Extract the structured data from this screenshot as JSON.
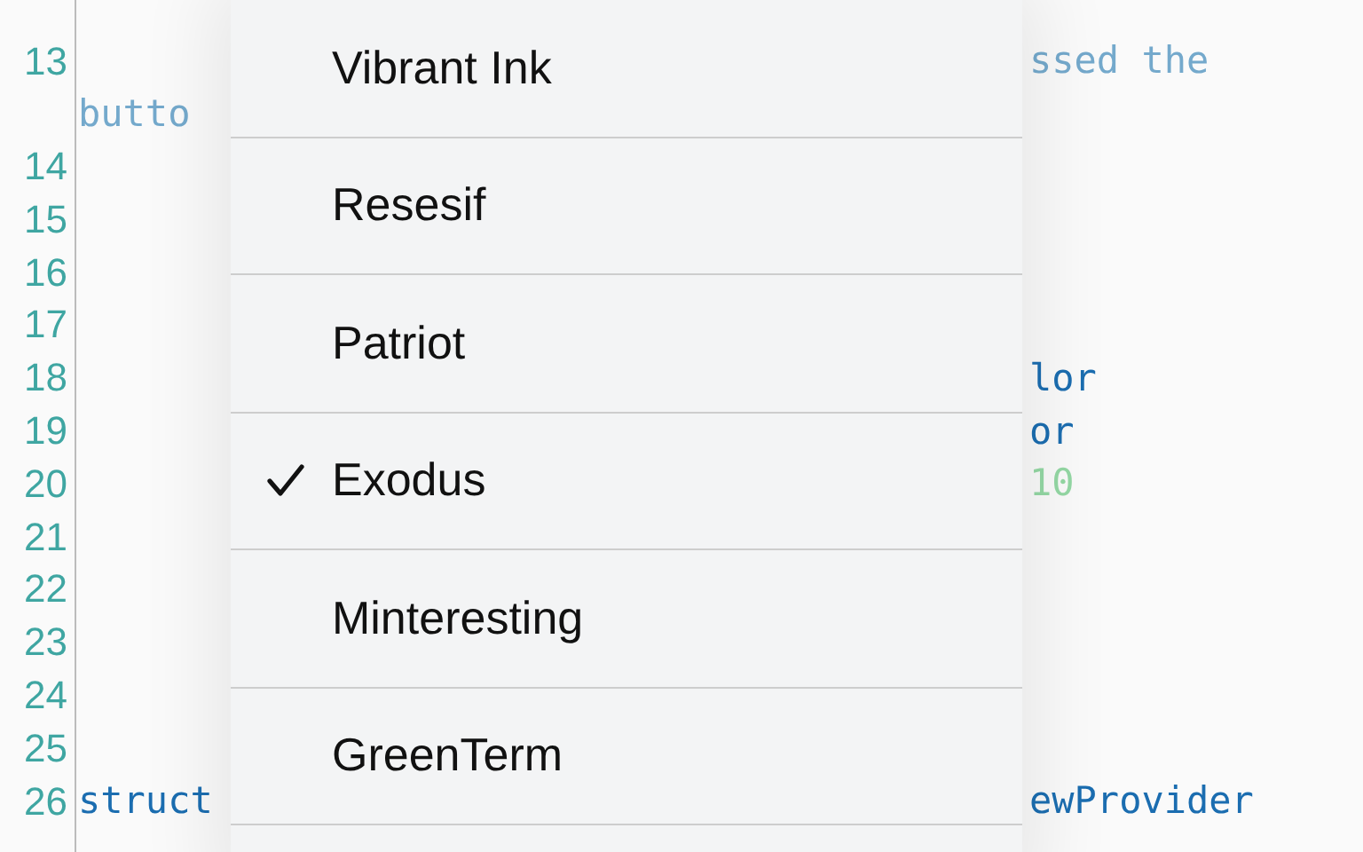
{
  "editor": {
    "lines": [
      {
        "number": "13",
        "right": {
          "text": "ssed the",
          "kind": "comment"
        }
      },
      {
        "left": {
          "text": "butto",
          "kind": "comment"
        }
      },
      {
        "number": "14"
      },
      {
        "number": "15"
      },
      {
        "number": "16"
      },
      {
        "number": "17"
      },
      {
        "number": "18",
        "right": {
          "text": "lor",
          "kind": "code"
        }
      },
      {
        "number": "19",
        "right": {
          "text": "or",
          "kind": "code"
        }
      },
      {
        "number": "20",
        "right": {
          "text": "10",
          "kind": "number"
        }
      },
      {
        "number": "21"
      },
      {
        "number": "22"
      },
      {
        "number": "23"
      },
      {
        "number": "24"
      },
      {
        "number": "25"
      },
      {
        "number": "26",
        "left": {
          "text": "struct",
          "kind": "code"
        },
        "right": {
          "text": "ewProvider",
          "kind": "code"
        }
      }
    ]
  },
  "menu": {
    "items": [
      {
        "label": "Vibrant Ink",
        "selected": false
      },
      {
        "label": "Resesif",
        "selected": false
      },
      {
        "label": "Patriot",
        "selected": false
      },
      {
        "label": "Exodus",
        "selected": true
      },
      {
        "label": "Minteresting",
        "selected": false
      },
      {
        "label": "GreenTerm",
        "selected": false
      }
    ]
  }
}
